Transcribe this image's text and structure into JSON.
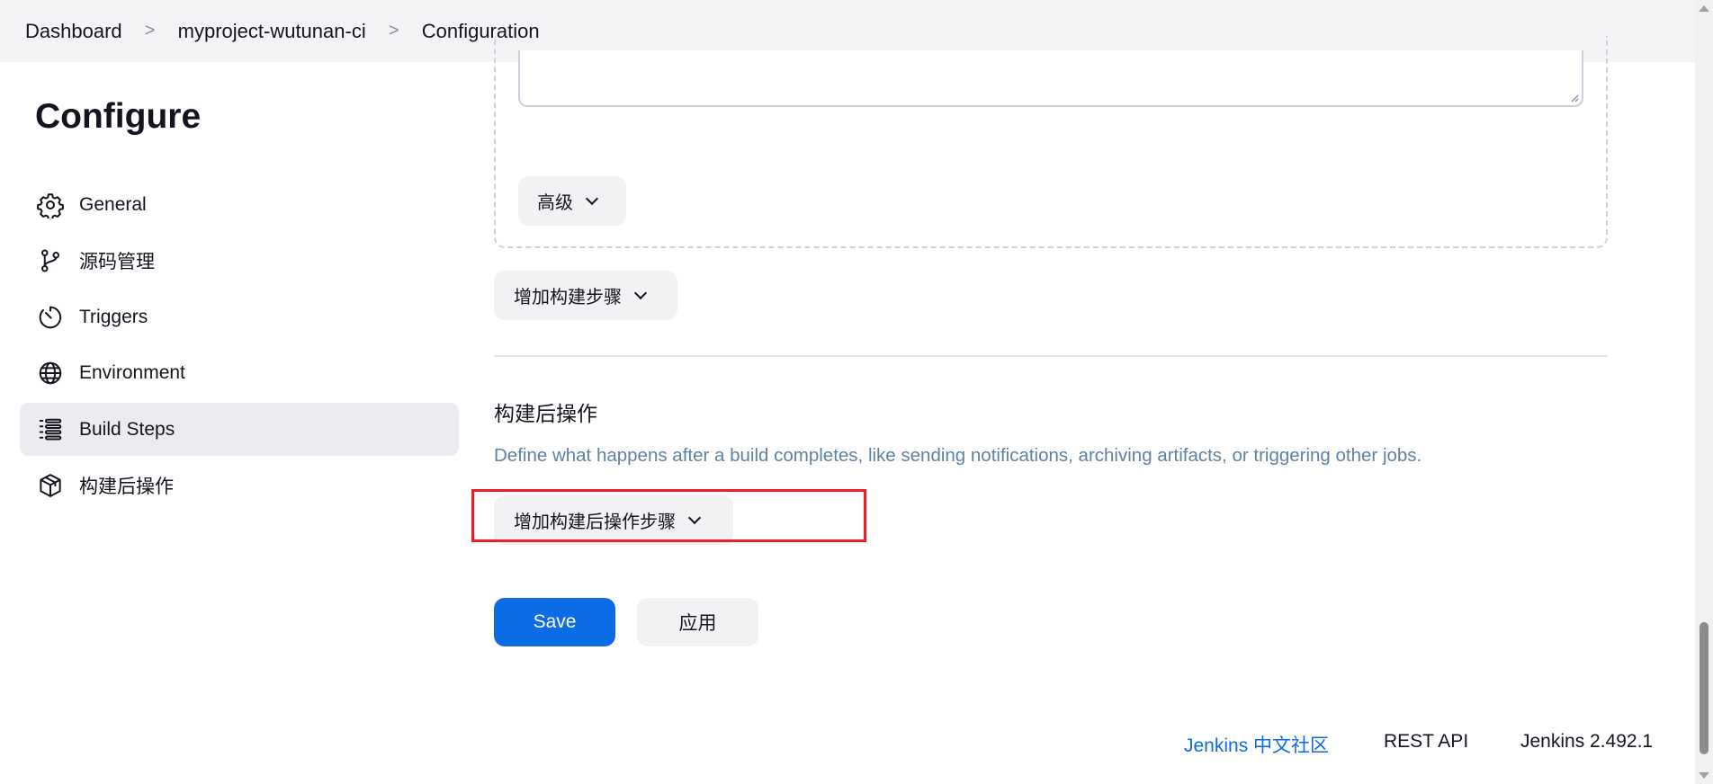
{
  "breadcrumb": {
    "items": [
      "Dashboard",
      "myproject-wutunan-ci",
      "Configuration"
    ],
    "separator": ">"
  },
  "sidebar": {
    "title": "Configure",
    "items": [
      {
        "label": "General",
        "icon": "gear-icon"
      },
      {
        "label": "源码管理",
        "icon": "source-branch-icon"
      },
      {
        "label": "Triggers",
        "icon": "timer-icon"
      },
      {
        "label": "Environment",
        "icon": "globe-icon"
      },
      {
        "label": "Build Steps",
        "icon": "list-icon",
        "active": true
      },
      {
        "label": "构建后操作",
        "icon": "package-icon"
      }
    ]
  },
  "main": {
    "advanced_label": "高级",
    "add_build_step_label": "增加构建步骤",
    "post_build": {
      "title": "构建后操作",
      "description": "Define what happens after a build completes, like sending notifications, archiving artifacts, or triggering other jobs.",
      "add_post_build_step_label": "增加构建后操作步骤"
    },
    "save_label": "Save",
    "apply_label": "应用"
  },
  "footer": {
    "community_label": "Jenkins 中文社区",
    "rest_api_label": "REST API",
    "version_label": "Jenkins 2.492.1"
  },
  "colors": {
    "accent": "#0b6ce6",
    "highlight": "#e8202a",
    "description": "#5f82a3"
  }
}
